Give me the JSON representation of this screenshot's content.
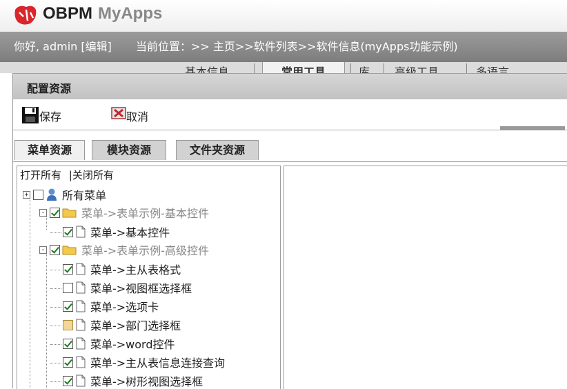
{
  "header": {
    "brand": "OBPM",
    "app": "MyApps"
  },
  "infobar": {
    "greeting": "你好, admin",
    "edit_link": "[编辑]",
    "location_label": "当前位置：",
    "breadcrumb": ">> 主页>>软件列表>>软件信息(myApps功能示例)"
  },
  "top_tabs": [
    {
      "label": "基本信息"
    },
    {
      "label": "常用工具"
    },
    {
      "label": "库"
    },
    {
      "label": "高级工具"
    },
    {
      "label": "多语言"
    }
  ],
  "panel": {
    "title": "配置资源"
  },
  "toolbar": {
    "save_label": "保存",
    "cancel_label": "取消"
  },
  "resource_tabs": [
    {
      "label": "菜单资源"
    },
    {
      "label": "模块资源"
    },
    {
      "label": "文件夹资源"
    }
  ],
  "tree": {
    "open_all": "打开所有",
    "close_all": "关闭所有",
    "root": "所有菜单",
    "groups": [
      {
        "label": "菜单->表单示例-基本控件",
        "state": "checked",
        "items": [
          {
            "label": "菜单->基本控件",
            "state": "checked"
          }
        ]
      },
      {
        "label": "菜单->表单示例-高级控件",
        "state": "checked",
        "items": [
          {
            "label": "菜单->主从表格式",
            "state": "checked"
          },
          {
            "label": "菜单->视图框选择框",
            "state": "unchecked"
          },
          {
            "label": "菜单->选项卡",
            "state": "checked"
          },
          {
            "label": "菜单->部门选择框",
            "state": "partial"
          },
          {
            "label": "菜单->word控件",
            "state": "checked"
          },
          {
            "label": "菜单->主从表信息连接查询",
            "state": "checked"
          },
          {
            "label": "菜单->树形视图选择框",
            "state": "checked"
          }
        ]
      }
    ]
  },
  "colors": {
    "check": "#1a7a1a",
    "folder": "#f2c94c",
    "logo": "#d9262c"
  }
}
